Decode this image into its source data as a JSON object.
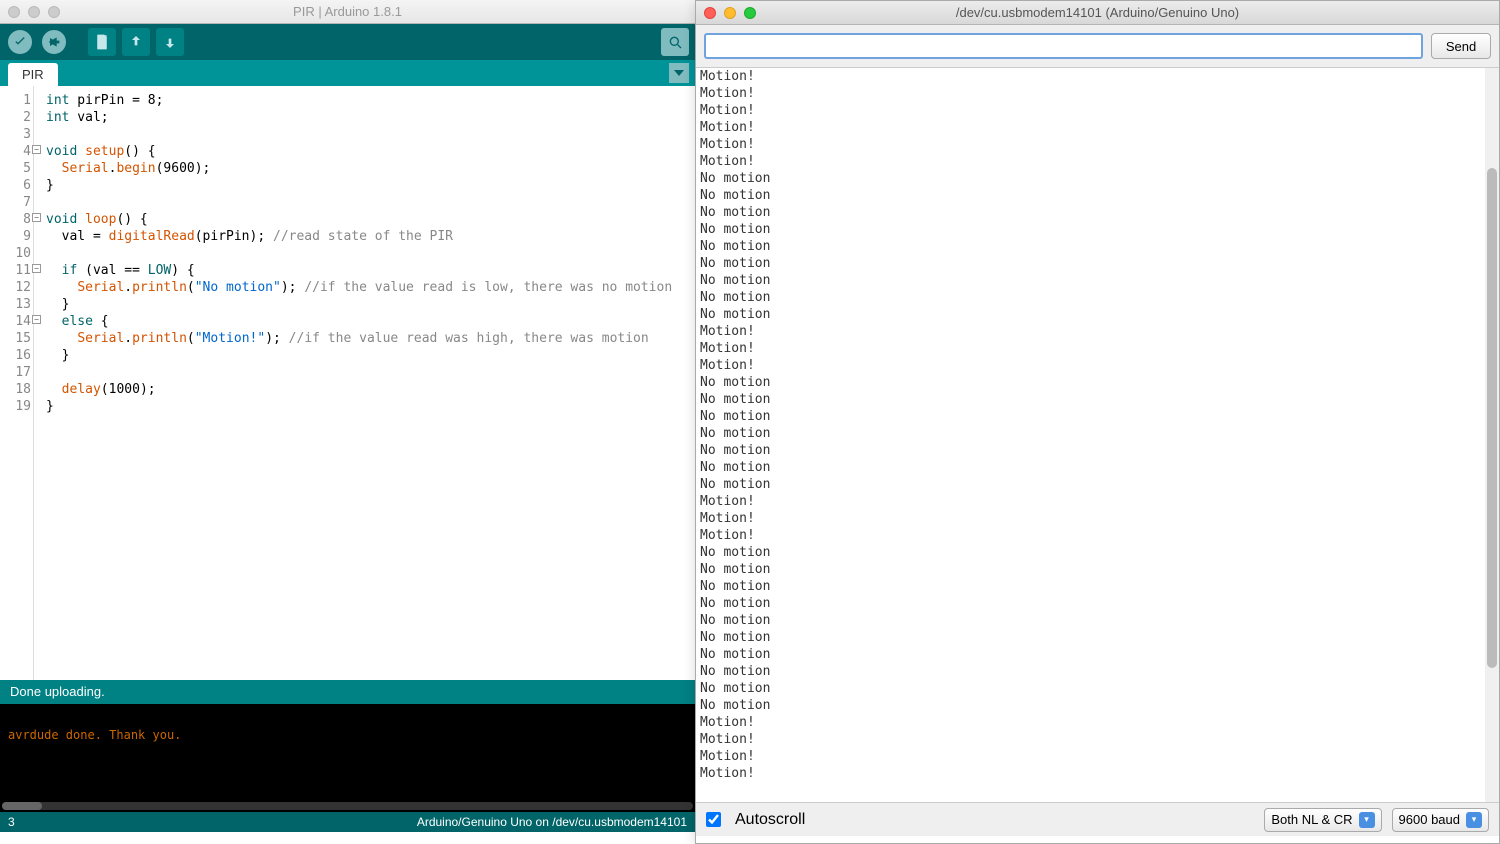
{
  "ide": {
    "title": "PIR | Arduino 1.8.1",
    "tab": "PIR",
    "status": "Done uploading.",
    "console": "avrdude done.  Thank you.",
    "bottom_left": "3",
    "bottom_right": "Arduino/Genuino Uno on /dev/cu.usbmodem14101",
    "code": [
      {
        "n": 1,
        "html": "<span class='kw'>int</span> pirPin = <span class='num'>8</span>;"
      },
      {
        "n": 2,
        "html": "<span class='kw'>int</span> val;"
      },
      {
        "n": 3,
        "html": ""
      },
      {
        "n": 4,
        "fold": true,
        "html": "<span class='kw'>void</span> <span class='fn'>setup</span>() {"
      },
      {
        "n": 5,
        "html": "  <span class='fn'>Serial</span>.<span class='fn'>begin</span>(<span class='num'>9600</span>);"
      },
      {
        "n": 6,
        "html": "}"
      },
      {
        "n": 7,
        "html": ""
      },
      {
        "n": 8,
        "fold": true,
        "html": "<span class='kw'>void</span> <span class='fn'>loop</span>() {"
      },
      {
        "n": 9,
        "html": "  val = <span class='fn'>digitalRead</span>(pirPin); <span class='cmt'>//read state of the PIR</span>"
      },
      {
        "n": 10,
        "html": ""
      },
      {
        "n": 11,
        "fold": true,
        "html": "  <span class='kw'>if</span> (val == <span class='const'>LOW</span>) {"
      },
      {
        "n": 12,
        "html": "    <span class='fn'>Serial</span>.<span class='fn'>println</span>(<span class='str'>\"No motion\"</span>); <span class='cmt'>//if the value read is low, there was no motion</span>"
      },
      {
        "n": 13,
        "html": "  }"
      },
      {
        "n": 14,
        "fold": true,
        "html": "  <span class='kw'>else</span> {"
      },
      {
        "n": 15,
        "html": "    <span class='fn'>Serial</span>.<span class='fn'>println</span>(<span class='str'>\"Motion!\"</span>); <span class='cmt'>//if the value read was high, there was motion</span>"
      },
      {
        "n": 16,
        "html": "  }"
      },
      {
        "n": 17,
        "html": ""
      },
      {
        "n": 18,
        "html": "  <span class='fn'>delay</span>(<span class='num'>1000</span>);"
      },
      {
        "n": 19,
        "html": "}"
      }
    ]
  },
  "serial": {
    "title": "/dev/cu.usbmodem14101 (Arduino/Genuino Uno)",
    "send": "Send",
    "input_value": "",
    "autoscroll_label": "Autoscroll",
    "autoscroll_checked": true,
    "line_ending": "Both NL & CR",
    "baud": "9600 baud",
    "lines": [
      "Motion!",
      "Motion!",
      "Motion!",
      "Motion!",
      "Motion!",
      "Motion!",
      "No motion",
      "No motion",
      "No motion",
      "No motion",
      "No motion",
      "No motion",
      "No motion",
      "No motion",
      "No motion",
      "Motion!",
      "Motion!",
      "Motion!",
      "No motion",
      "No motion",
      "No motion",
      "No motion",
      "No motion",
      "No motion",
      "No motion",
      "Motion!",
      "Motion!",
      "Motion!",
      "No motion",
      "No motion",
      "No motion",
      "No motion",
      "No motion",
      "No motion",
      "No motion",
      "No motion",
      "No motion",
      "No motion",
      "Motion!",
      "Motion!",
      "Motion!",
      "Motion!"
    ]
  }
}
